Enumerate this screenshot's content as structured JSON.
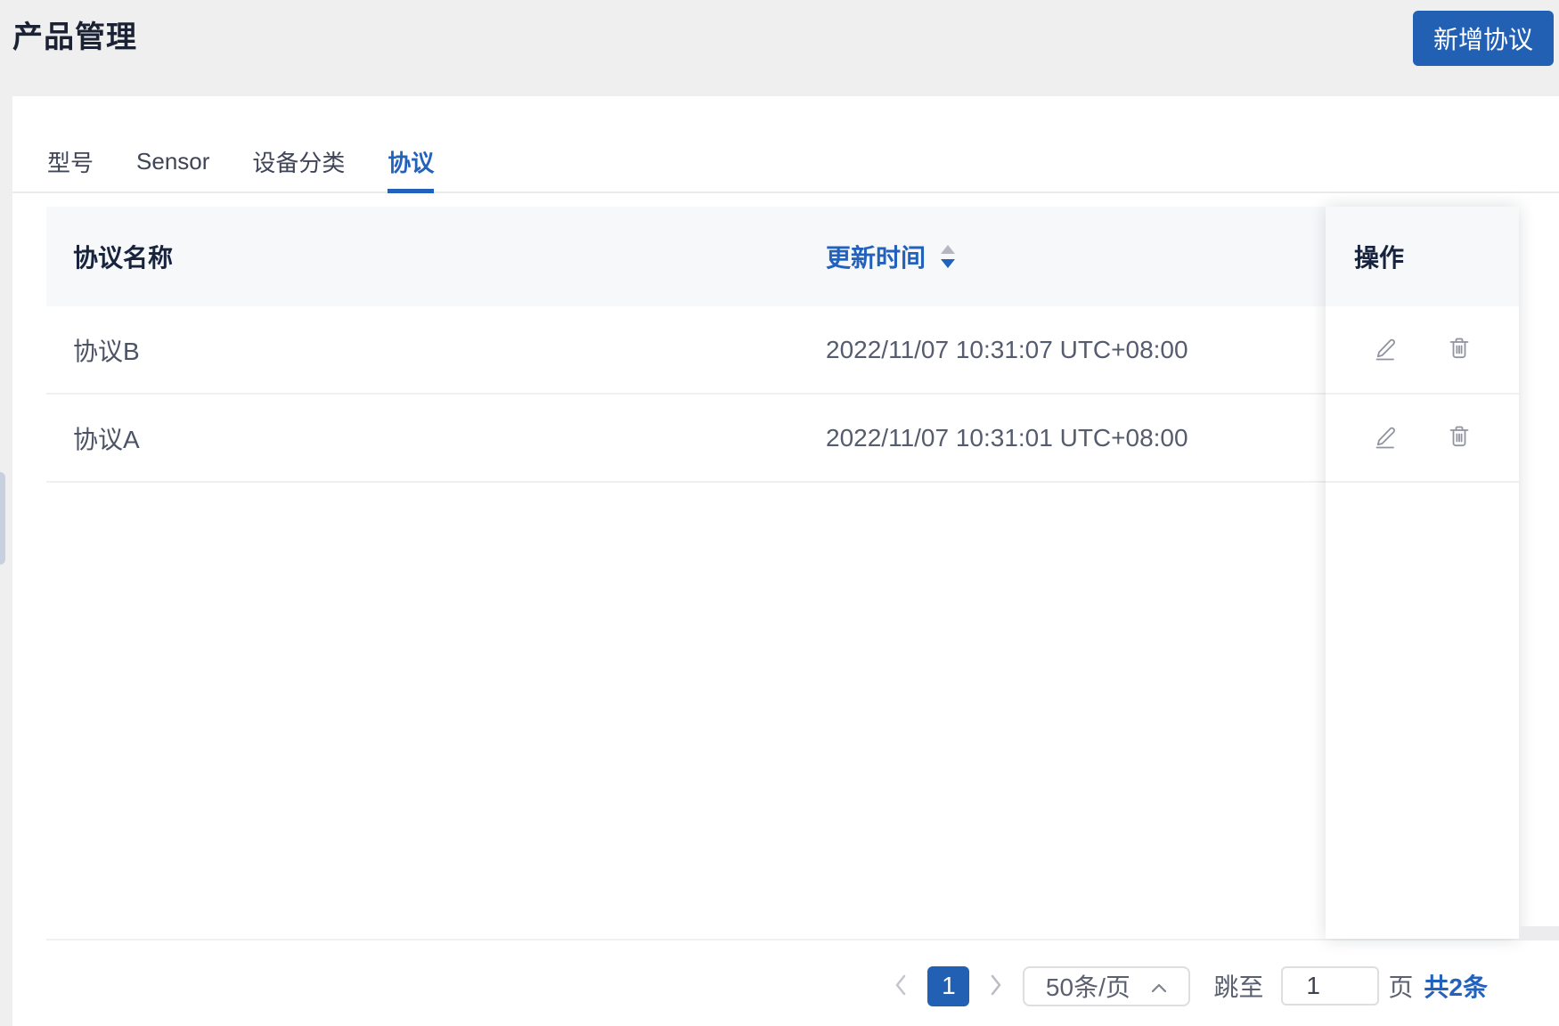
{
  "page": {
    "title": "产品管理"
  },
  "header": {
    "add_button": "新增协议"
  },
  "tabs": [
    {
      "label": "型号",
      "active": false
    },
    {
      "label": "Sensor",
      "active": false
    },
    {
      "label": "设备分类",
      "active": false
    },
    {
      "label": "协议",
      "active": true
    }
  ],
  "table": {
    "columns": {
      "name": "协议名称",
      "updated": "更新时间",
      "ops": "操作"
    },
    "sort": {
      "column": "更新时间",
      "direction": "desc"
    },
    "rows": [
      {
        "name": "协议B",
        "updated": "2022/11/07 10:31:07 UTC+08:00"
      },
      {
        "name": "协议A",
        "updated": "2022/11/07 10:31:01 UTC+08:00"
      }
    ]
  },
  "pagination": {
    "current_page": "1",
    "page_size": "50条/页",
    "jump_label": "跳至",
    "jump_value": "1",
    "page_unit": "页",
    "total": "共2条"
  },
  "icons": {
    "row_actions": [
      "pencil-icon",
      "trash-icon"
    ],
    "sort": "sort-caret-icon",
    "pager": [
      "chevron-left-icon",
      "chevron-right-icon"
    ],
    "page_size_select": "chevron-up-icon"
  },
  "colors": {
    "accent": "#2260b4",
    "page_background": "#efeff0",
    "card_background": "#ffffff",
    "table_header_background": "#f7f8fa",
    "icon_gray": "#8f949e"
  }
}
